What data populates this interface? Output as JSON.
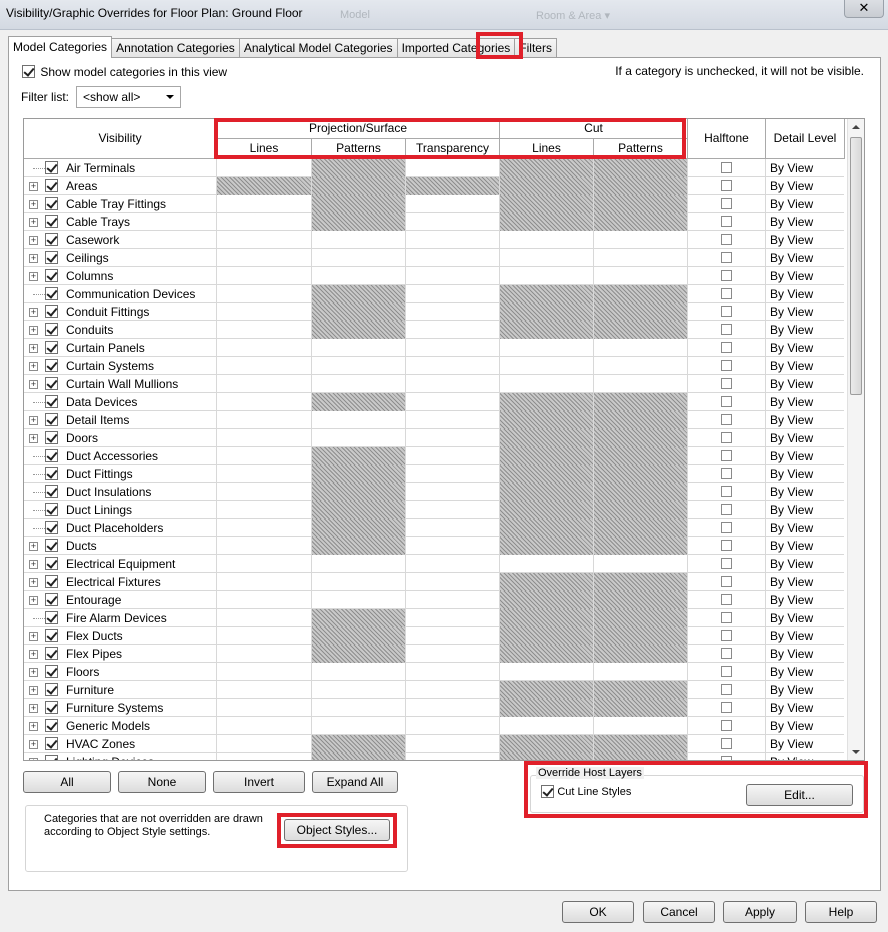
{
  "window": {
    "title": "Visibility/Graphic Overrides for Floor Plan: Ground Floor",
    "bg_model": "Model",
    "bg_menu": "Room & Area ▾",
    "close_glyph": "✕"
  },
  "tabs": [
    "Model Categories",
    "Annotation Categories",
    "Analytical Model Categories",
    "Imported Categories",
    "Filters"
  ],
  "show_categories_label": "Show model categories in this view",
  "hint": "If a category is unchecked, it will not be visible.",
  "filter": {
    "label": "Filter list:",
    "value": "<show all>"
  },
  "table": {
    "headers": {
      "visibility": "Visibility",
      "projection": "Projection/Surface",
      "cut": "Cut",
      "lines": "Lines",
      "patterns": "Patterns",
      "transparency": "Transparency",
      "cut_lines": "Lines",
      "cut_patterns": "Patterns",
      "halftone": "Halftone",
      "detail_level": "Detail Level"
    },
    "rows": [
      {
        "name": "Air Terminals",
        "expand": false,
        "h": [
          0,
          1,
          0,
          1,
          1
        ]
      },
      {
        "name": "Areas",
        "expand": true,
        "h": [
          1,
          1,
          1,
          1,
          1
        ]
      },
      {
        "name": "Cable Tray Fittings",
        "expand": true,
        "h": [
          0,
          1,
          0,
          1,
          1
        ]
      },
      {
        "name": "Cable Trays",
        "expand": true,
        "h": [
          0,
          1,
          0,
          1,
          1
        ]
      },
      {
        "name": "Casework",
        "expand": true,
        "h": [
          0,
          0,
          0,
          0,
          0
        ]
      },
      {
        "name": "Ceilings",
        "expand": true,
        "h": [
          0,
          0,
          0,
          0,
          0
        ]
      },
      {
        "name": "Columns",
        "expand": true,
        "h": [
          0,
          0,
          0,
          0,
          0
        ]
      },
      {
        "name": "Communication Devices",
        "expand": false,
        "h": [
          0,
          1,
          0,
          1,
          1
        ]
      },
      {
        "name": "Conduit Fittings",
        "expand": true,
        "h": [
          0,
          1,
          0,
          1,
          1
        ]
      },
      {
        "name": "Conduits",
        "expand": true,
        "h": [
          0,
          1,
          0,
          1,
          1
        ]
      },
      {
        "name": "Curtain Panels",
        "expand": true,
        "h": [
          0,
          0,
          0,
          0,
          0
        ]
      },
      {
        "name": "Curtain Systems",
        "expand": true,
        "h": [
          0,
          0,
          0,
          0,
          0
        ]
      },
      {
        "name": "Curtain Wall Mullions",
        "expand": true,
        "h": [
          0,
          0,
          0,
          0,
          0
        ]
      },
      {
        "name": "Data Devices",
        "expand": false,
        "h": [
          0,
          1,
          0,
          1,
          1
        ]
      },
      {
        "name": "Detail Items",
        "expand": true,
        "h": [
          0,
          0,
          0,
          1,
          1
        ]
      },
      {
        "name": "Doors",
        "expand": true,
        "h": [
          0,
          0,
          0,
          1,
          1
        ]
      },
      {
        "name": "Duct Accessories",
        "expand": false,
        "h": [
          0,
          1,
          0,
          1,
          1
        ]
      },
      {
        "name": "Duct Fittings",
        "expand": false,
        "h": [
          0,
          1,
          0,
          1,
          1
        ]
      },
      {
        "name": "Duct Insulations",
        "expand": false,
        "h": [
          0,
          1,
          0,
          1,
          1
        ]
      },
      {
        "name": "Duct Linings",
        "expand": false,
        "h": [
          0,
          1,
          0,
          1,
          1
        ]
      },
      {
        "name": "Duct Placeholders",
        "expand": false,
        "h": [
          0,
          1,
          0,
          1,
          1
        ]
      },
      {
        "name": "Ducts",
        "expand": true,
        "h": [
          0,
          1,
          0,
          1,
          1
        ]
      },
      {
        "name": "Electrical Equipment",
        "expand": true,
        "h": [
          0,
          0,
          0,
          0,
          0
        ]
      },
      {
        "name": "Electrical Fixtures",
        "expand": true,
        "h": [
          0,
          0,
          0,
          1,
          1
        ]
      },
      {
        "name": "Entourage",
        "expand": true,
        "h": [
          0,
          0,
          0,
          1,
          1
        ]
      },
      {
        "name": "Fire Alarm Devices",
        "expand": false,
        "h": [
          0,
          1,
          0,
          1,
          1
        ]
      },
      {
        "name": "Flex Ducts",
        "expand": true,
        "h": [
          0,
          1,
          0,
          1,
          1
        ]
      },
      {
        "name": "Flex Pipes",
        "expand": true,
        "h": [
          0,
          1,
          0,
          1,
          1
        ]
      },
      {
        "name": "Floors",
        "expand": true,
        "h": [
          0,
          0,
          0,
          0,
          0
        ]
      },
      {
        "name": "Furniture",
        "expand": true,
        "h": [
          0,
          0,
          0,
          1,
          1
        ]
      },
      {
        "name": "Furniture Systems",
        "expand": true,
        "h": [
          0,
          0,
          0,
          1,
          1
        ]
      },
      {
        "name": "Generic Models",
        "expand": true,
        "h": [
          0,
          0,
          0,
          0,
          0
        ]
      },
      {
        "name": "HVAC Zones",
        "expand": true,
        "h": [
          0,
          1,
          0,
          1,
          1
        ]
      },
      {
        "name": "Lighting Devices",
        "expand": true,
        "h": [
          0,
          1,
          0,
          1,
          1
        ]
      }
    ],
    "detail_value": "By View"
  },
  "buttons": {
    "all": "All",
    "none": "None",
    "invert": "Invert",
    "expand_all": "Expand All",
    "object_styles": "Object Styles...",
    "edit": "Edit...",
    "ok": "OK",
    "cancel": "Cancel",
    "apply": "Apply",
    "help": "Help"
  },
  "note": {
    "line1": "Categories that are not overridden are drawn",
    "line2": "according to Object Style settings."
  },
  "override": {
    "legend": "Override Host Layers",
    "cut_line_styles": "Cut Line Styles"
  },
  "colors": {
    "highlight": "#e0202a",
    "hatch": "#8e8e8e"
  }
}
